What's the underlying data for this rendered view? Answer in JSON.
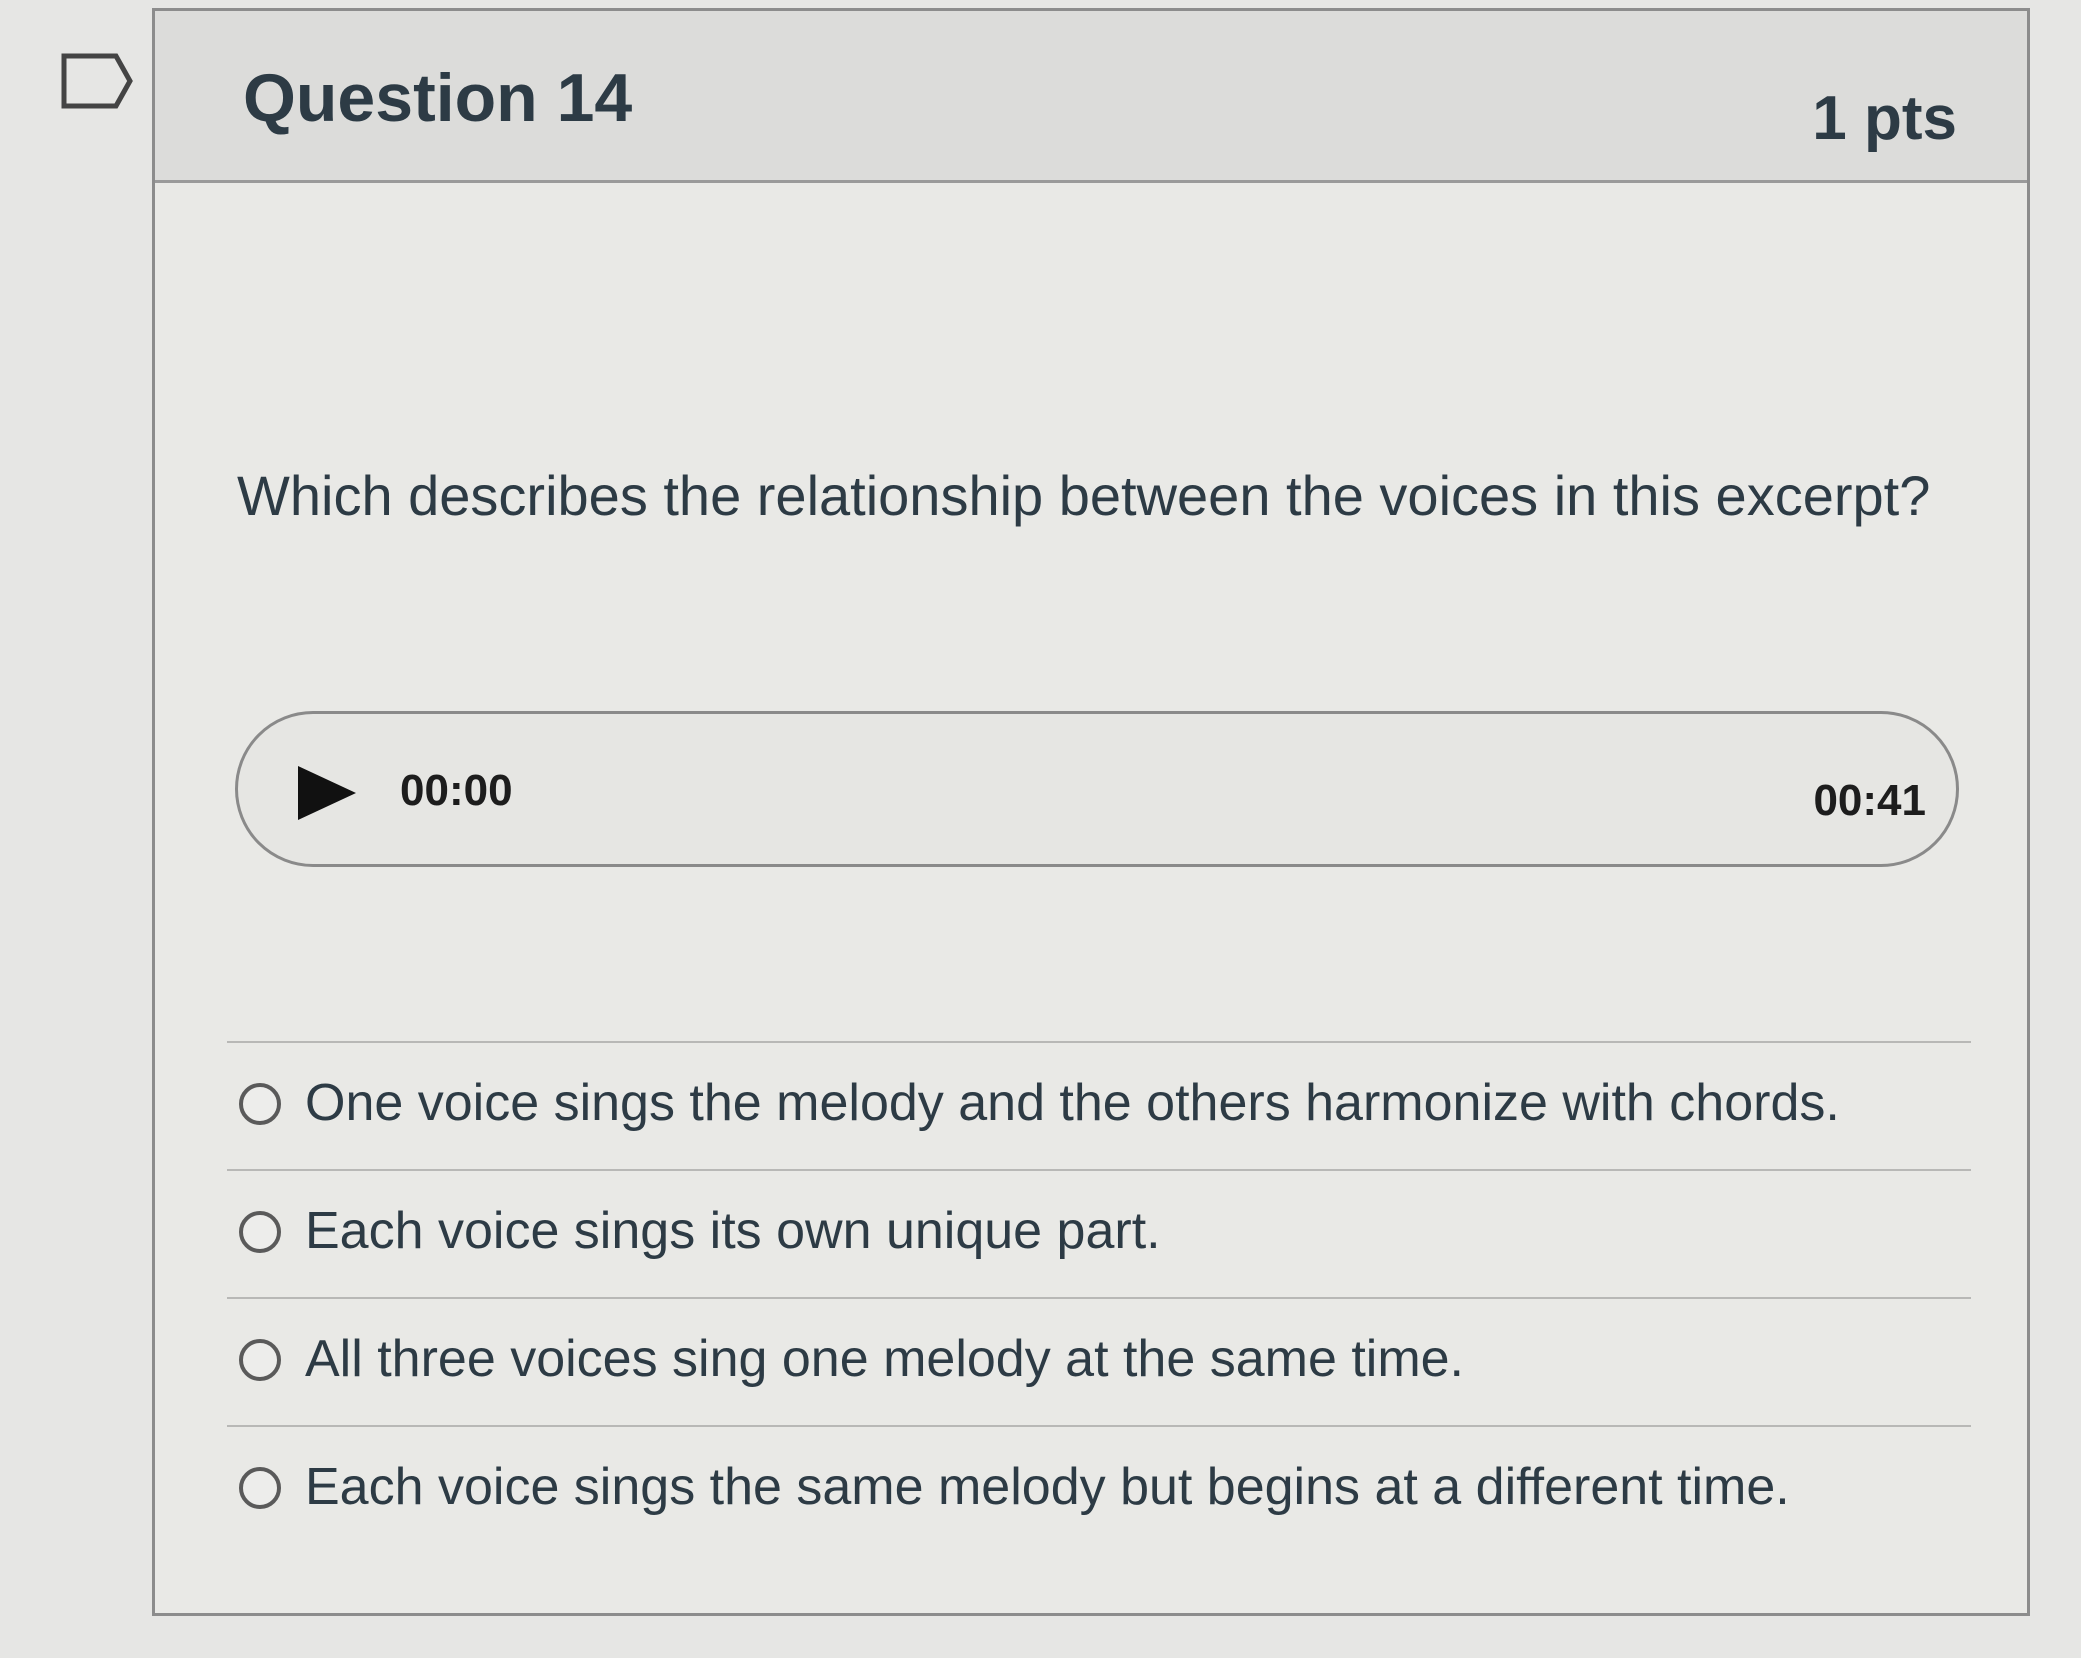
{
  "question": {
    "title": "Question 14",
    "points": "1 pts",
    "text": "Which describes the relationship between the voices in this excerpt?"
  },
  "audio_player": {
    "current_time": "00:00",
    "duration": "00:41",
    "play_icon": "play-icon",
    "progress_fraction": 0
  },
  "answers": [
    {
      "label": "One voice sings the melody and the others harmonize with chords.",
      "selected": false
    },
    {
      "label": "Each voice sings its own unique part.",
      "selected": false
    },
    {
      "label": "All three voices sing one melody at the same time.",
      "selected": false
    },
    {
      "label": "Each voice sings the same melody but begins at a different time.",
      "selected": false
    }
  ],
  "flag": {
    "icon": "flag-icon"
  }
}
